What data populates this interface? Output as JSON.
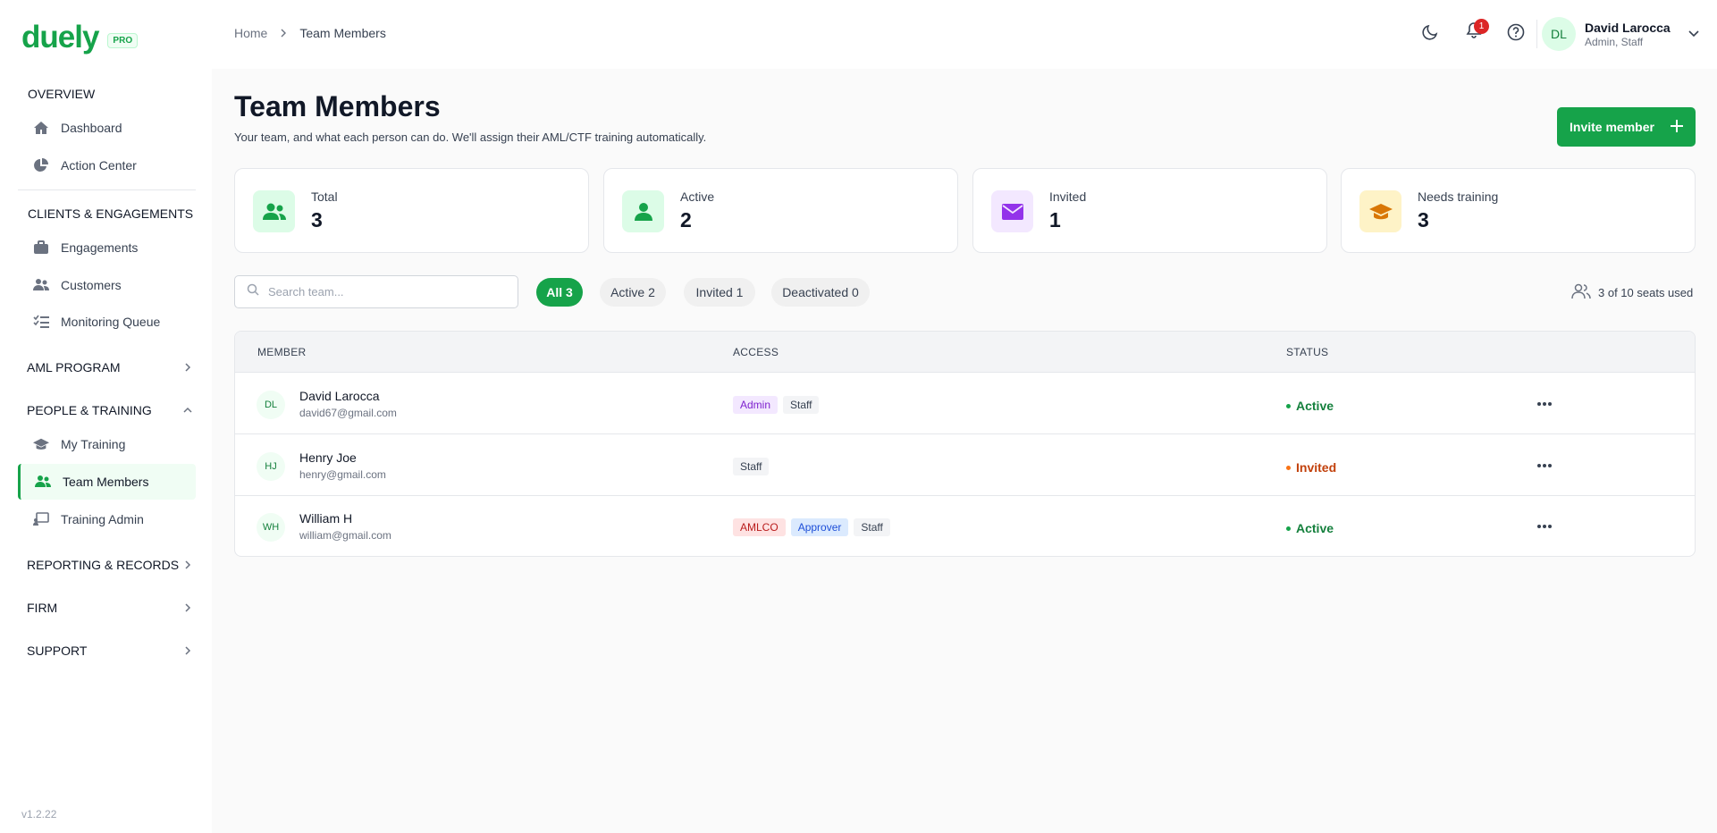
{
  "app": {
    "logo": "duely",
    "badge": "PRO",
    "version": "v1.2.22"
  },
  "sidebar": {
    "overview": "OVERVIEW",
    "dashboard": "Dashboard",
    "action_center": "Action Center",
    "clients": "CLIENTS & ENGAGEMENTS",
    "engagements": "Engagements",
    "customers": "Customers",
    "monitoring": "Monitoring Queue",
    "aml": "AML PROGRAM",
    "people": "PEOPLE & TRAINING",
    "my_training": "My Training",
    "team_members": "Team Members",
    "training_admin": "Training Admin",
    "reporting": "REPORTING & RECORDS",
    "firm": "FIRM",
    "support": "SUPPORT"
  },
  "header": {
    "breadcrumb": [
      "Home",
      "Team Members"
    ],
    "notifications": "1",
    "user": {
      "initials": "DL",
      "name": "David Larocca",
      "role": "Admin, Staff"
    }
  },
  "page": {
    "title": "Team Members",
    "subtitle": "Your team, and what each person can do. We'll assign their AML/CTF training automatically.",
    "invite": "Invite member"
  },
  "stats": [
    {
      "label": "Total",
      "value": "3"
    },
    {
      "label": "Active",
      "value": "2"
    },
    {
      "label": "Invited",
      "value": "1"
    },
    {
      "label": "Needs training",
      "value": "3"
    }
  ],
  "filters": {
    "search_placeholder": "Search team...",
    "chips": [
      "All 3",
      "Active 2",
      "Invited 1",
      "Deactivated 0"
    ],
    "seats": "3 of 10 seats used"
  },
  "table": {
    "headers": [
      "MEMBER",
      "ACCESS",
      "STATUS"
    ],
    "rows": [
      {
        "initials": "DL",
        "name": "David Larocca",
        "email": "david67@gmail.com",
        "tags": [
          "Admin",
          "Staff"
        ],
        "status": "Active"
      },
      {
        "initials": "HJ",
        "name": "Henry Joe",
        "email": "henry@gmail.com",
        "tags": [
          "Staff"
        ],
        "status": "Invited"
      },
      {
        "initials": "WH",
        "name": "William H",
        "email": "william@gmail.com",
        "tags": [
          "AMLCO",
          "Approver",
          "Staff"
        ],
        "status": "Active"
      }
    ]
  },
  "colors": {
    "accent": "#16a34a",
    "invited": "#c2410c",
    "notification": "#dc2626"
  }
}
